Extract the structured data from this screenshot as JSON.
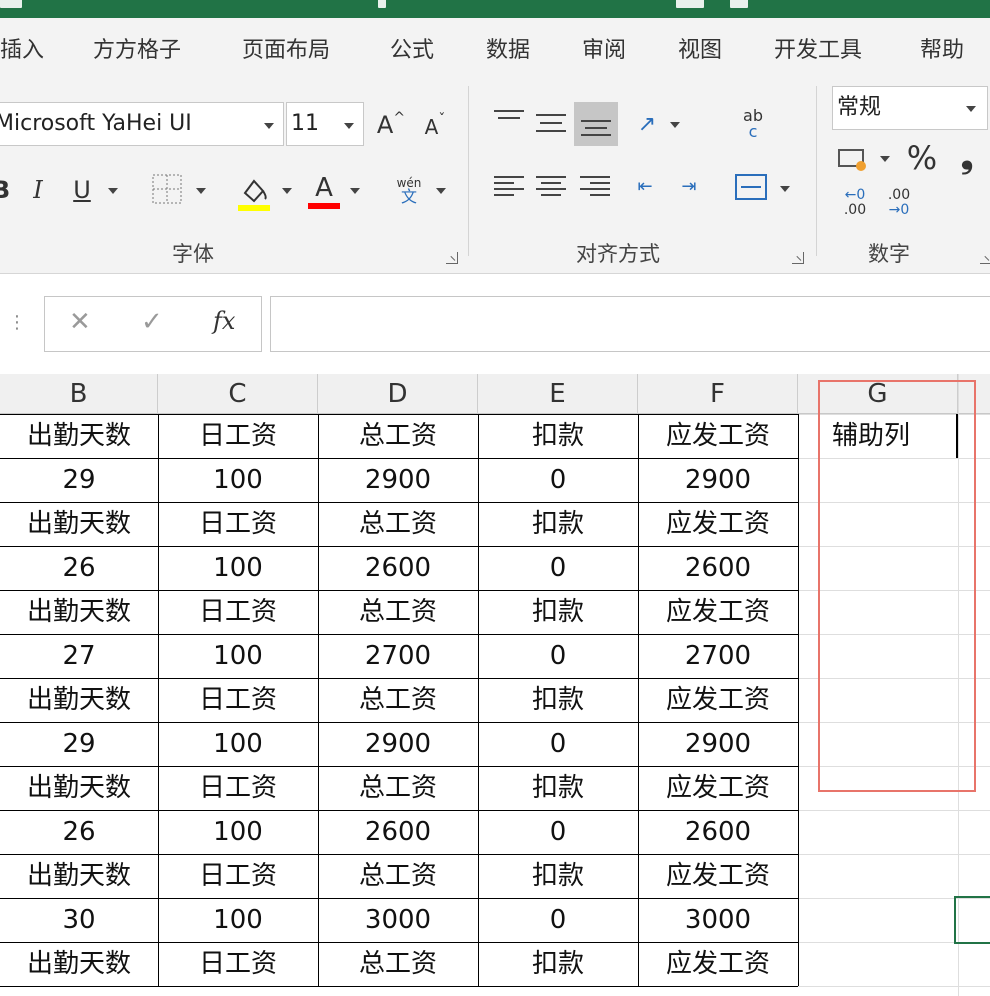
{
  "tabs": [
    "插入",
    "方方格子",
    "页面布局",
    "公式",
    "数据",
    "审阅",
    "视图",
    "开发工具",
    "帮助"
  ],
  "ribbon": {
    "font_name": "Microsoft YaHei UI",
    "font_size": "11",
    "grow_font": "A",
    "shrink_font": "A",
    "italic": "I",
    "underline": "U",
    "font_color": "A",
    "phonetic_top": "wén",
    "phonetic_bottom": "文",
    "wrap_top": "ab",
    "wrap_bottom": "c",
    "number_format": "常规",
    "percent": "%",
    "comma": "❟",
    "dec_increase_top": "←0",
    "dec_increase_bottom": ".00",
    "dec_decrease_top": ".00",
    "dec_decrease_bottom": "→0",
    "group_font": "字体",
    "group_align": "对齐方式",
    "group_number": "数字",
    "fill_color": "#ffff00",
    "font_color_bar": "#ff0000"
  },
  "formula_bar": {
    "cancel": "✕",
    "enter": "✓",
    "fx": "fx",
    "value": ""
  },
  "columns": [
    "B",
    "C",
    "D",
    "E",
    "F",
    "G"
  ],
  "rows": [
    [
      "出勤天数",
      "日工资",
      "总工资",
      "扣款",
      "应发工资",
      "辅助列"
    ],
    [
      "29",
      "100",
      "2900",
      "0",
      "2900",
      ""
    ],
    [
      "出勤天数",
      "日工资",
      "总工资",
      "扣款",
      "应发工资",
      ""
    ],
    [
      "26",
      "100",
      "2600",
      "0",
      "2600",
      ""
    ],
    [
      "出勤天数",
      "日工资",
      "总工资",
      "扣款",
      "应发工资",
      ""
    ],
    [
      "27",
      "100",
      "2700",
      "0",
      "2700",
      ""
    ],
    [
      "出勤天数",
      "日工资",
      "总工资",
      "扣款",
      "应发工资",
      ""
    ],
    [
      "29",
      "100",
      "2900",
      "0",
      "2900",
      ""
    ],
    [
      "出勤天数",
      "日工资",
      "总工资",
      "扣款",
      "应发工资",
      ""
    ],
    [
      "26",
      "100",
      "2600",
      "0",
      "2600",
      ""
    ],
    [
      "出勤天数",
      "日工资",
      "总工资",
      "扣款",
      "应发工资",
      ""
    ],
    [
      "30",
      "100",
      "3000",
      "0",
      "3000",
      ""
    ],
    [
      "出勤天数",
      "日工资",
      "总工资",
      "扣款",
      "应发工资",
      ""
    ]
  ],
  "colors": {
    "excel_green": "#217346",
    "highlight_box": "#e8746a"
  }
}
